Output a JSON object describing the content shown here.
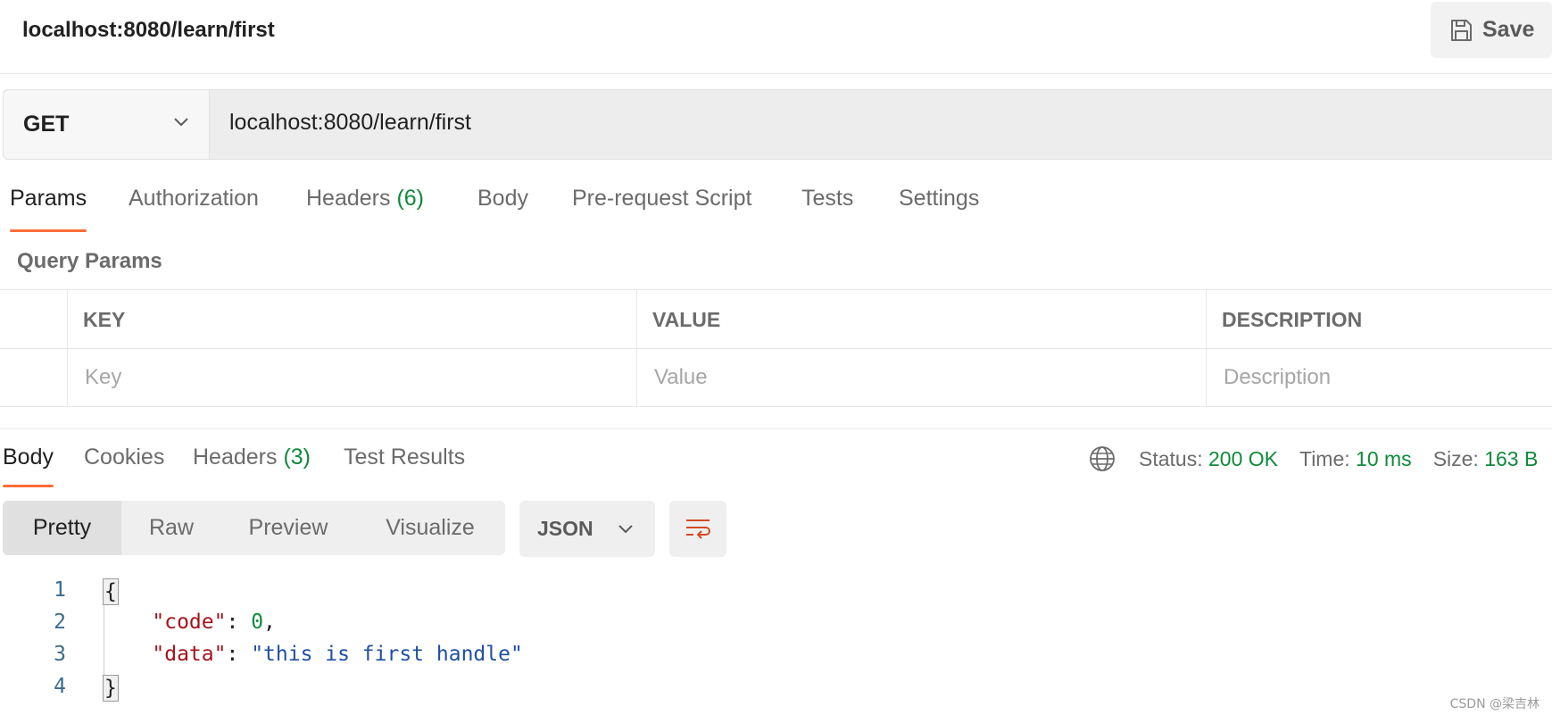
{
  "request": {
    "title": "localhost:8080/learn/first",
    "save_label": "Save",
    "method": "GET",
    "url": "localhost:8080/learn/first"
  },
  "request_tabs": {
    "params": "Params",
    "authorization": "Authorization",
    "headers": "Headers",
    "headers_count": "(6)",
    "body": "Body",
    "pre_request": "Pre-request Script",
    "tests": "Tests",
    "settings": "Settings"
  },
  "query_params": {
    "title": "Query Params",
    "columns": [
      "KEY",
      "VALUE",
      "DESCRIPTION"
    ],
    "placeholders": [
      "Key",
      "Value",
      "Description"
    ]
  },
  "response_tabs": {
    "body": "Body",
    "cookies": "Cookies",
    "headers": "Headers",
    "headers_count": "(3)",
    "test_results": "Test Results"
  },
  "status": {
    "status_label": "Status:",
    "status_value": "200 OK",
    "time_label": "Time:",
    "time_value": "10 ms",
    "size_label": "Size:",
    "size_value": "163 B"
  },
  "view_modes": [
    "Pretty",
    "Raw",
    "Preview",
    "Visualize"
  ],
  "format": "JSON",
  "code": {
    "line_numbers": [
      "1",
      "2",
      "3",
      "4"
    ],
    "open_brace": "{",
    "close_brace": "}",
    "key1": "\"code\"",
    "val1": "0",
    "key2": "\"data\"",
    "val2": "\"this is first handle\""
  },
  "watermark": "CSDN @梁吉林",
  "colors": {
    "accent": "#ff6c37",
    "success": "#0f8a3b",
    "json_key": "#a3141c",
    "json_string": "#1f4fa3"
  }
}
